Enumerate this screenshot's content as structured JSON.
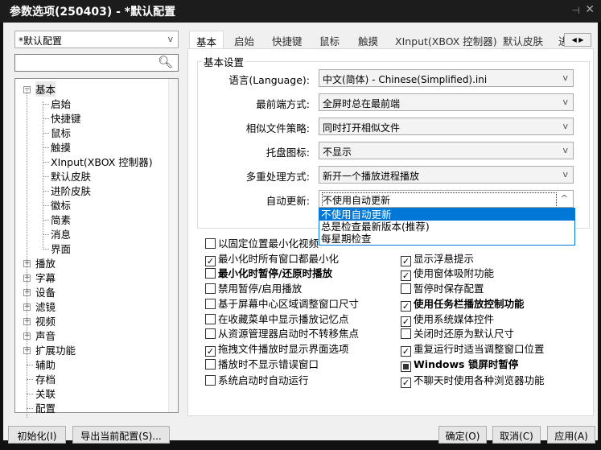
{
  "window": {
    "title": "参数选项(250403) - *默认配置",
    "pin_icon": "pin-icon",
    "close_icon": "close-icon"
  },
  "profile": {
    "value": "*默认配置"
  },
  "search": {
    "value": "",
    "placeholder": ""
  },
  "tree": [
    {
      "label": "基本",
      "expanded": true,
      "children": [
        "启始",
        "快捷键",
        "鼠标",
        "触摸",
        "XInput(XBOX 控制器)",
        "默认皮肤",
        "进阶皮肤",
        "徽标",
        "简素",
        "消息",
        "界面"
      ]
    },
    {
      "label": "播放",
      "expandable": true
    },
    {
      "label": "字幕",
      "expandable": true
    },
    {
      "label": "设备",
      "expandable": true
    },
    {
      "label": "滤镜",
      "expandable": true
    },
    {
      "label": "视频",
      "expandable": true
    },
    {
      "label": "声音",
      "expandable": true
    },
    {
      "label": "扩展功能",
      "expandable": true
    },
    {
      "label": "辅助"
    },
    {
      "label": "存档"
    },
    {
      "label": "关联"
    },
    {
      "label": "配置"
    }
  ],
  "tabs": [
    "基本",
    "启始",
    "快捷键",
    "鼠标",
    "触摸",
    "XInput(XBOX 控制器)",
    "默认皮肤",
    "进"
  ],
  "active_tab": "基本",
  "group": {
    "title": "基本设置"
  },
  "fields": [
    {
      "label": "语言(Language):",
      "value": "中文(简体) - Chinese(Simplified).ini"
    },
    {
      "label": "最前端方式:",
      "value": "全屏时总在最前端"
    },
    {
      "label": "相似文件策略:",
      "value": "同时打开相似文件"
    },
    {
      "label": "托盘图标:",
      "value": "不显示"
    },
    {
      "label": "多重处理方式:",
      "value": "新开一个播放进程播放"
    },
    {
      "label": "自动更新:",
      "value": "不使用自动更新",
      "open": true,
      "options": [
        "不使用自动更新",
        "总是检查最新版本(推荐)",
        "每星期检查"
      ],
      "highlighted": "不使用自动更新"
    }
  ],
  "checks_left": [
    {
      "label": "以固定位置最小化视频",
      "checked": false
    },
    {
      "label": "最小化时所有窗口都最小化",
      "checked": true
    },
    {
      "label": "最小化时暂停/还原时播放",
      "checked": false,
      "bold": true
    },
    {
      "label": "禁用暂停/启用播放",
      "checked": false
    },
    {
      "label": "基于屏幕中心区域调整窗口尺寸",
      "checked": false
    },
    {
      "label": "在收藏菜单中显示播放记忆点",
      "checked": false
    },
    {
      "label": "从资源管理器启动时不转移焦点",
      "checked": false
    },
    {
      "label": "拖拽文件播放时显示界面选项",
      "checked": true
    },
    {
      "label": "播放时不显示错误窗口",
      "checked": false
    },
    {
      "label": "系统启动时自动运行",
      "checked": false
    }
  ],
  "checks_right": [
    {
      "label": "显示浮悬提示",
      "checked": true
    },
    {
      "label": "使用窗体吸附功能",
      "checked": true
    },
    {
      "label": "暂停时保存配置",
      "checked": false
    },
    {
      "label": "使用任务栏播放控制功能",
      "checked": true,
      "bold": true
    },
    {
      "label": "使用系统媒体控件",
      "checked": true
    },
    {
      "label": "关闭时还原为默认尺寸",
      "checked": false
    },
    {
      "label": "重复运行时适当调整窗口位置",
      "checked": true
    },
    {
      "label": "Windows 锁屏时暂停",
      "checked": "indeterminate",
      "bold": true
    },
    {
      "label": "不聊天时使用各种浏览器功能",
      "checked": true
    }
  ],
  "buttons": {
    "init": "初始化(I)",
    "export": "导出当前配置(S)...",
    "ok": "确定(O)",
    "cancel": "取消(C)",
    "apply": "应用(A)"
  },
  "colors": {
    "highlight": "#0078d7",
    "titlebar": "#1c1c1c"
  }
}
